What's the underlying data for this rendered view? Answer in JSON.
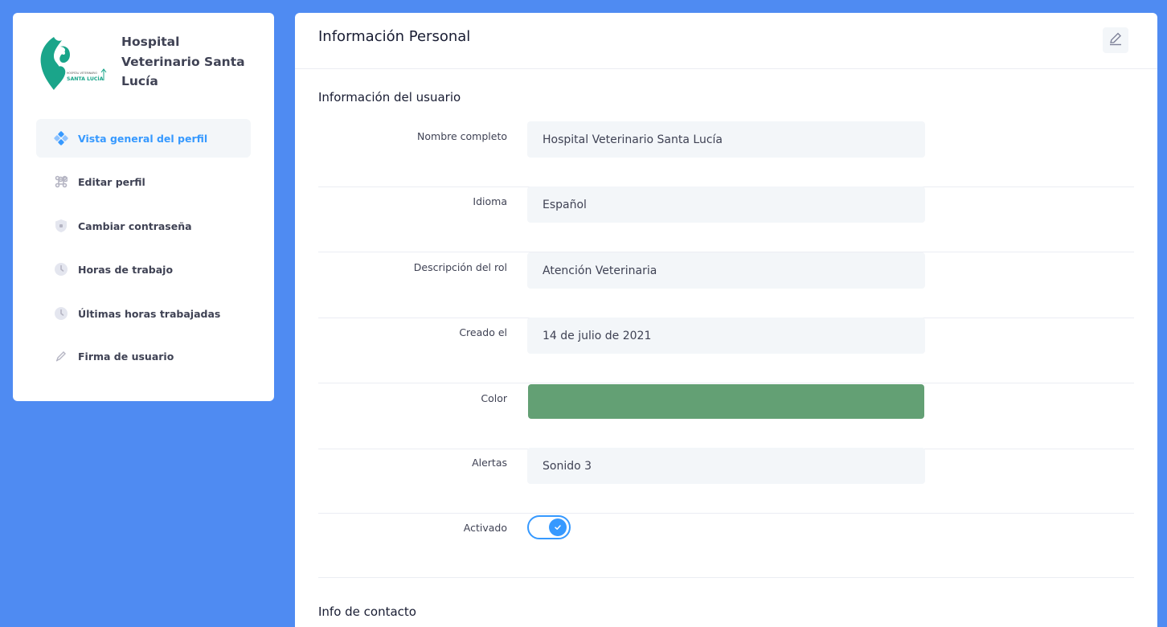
{
  "sidebar": {
    "brand_name": "Hospital Veterinario Santa Lucía",
    "logo_text_small": "HOSPITAL VETERINARIO",
    "logo_text_main": "SANTA LUCÍA",
    "logo_color": "#1aa58a",
    "items": [
      {
        "label": "Vista general del perfil",
        "icon": "profile-overview-icon",
        "active": true
      },
      {
        "label": "Editar perfil",
        "icon": "command-icon",
        "active": false
      },
      {
        "label": "Cambiar contraseña",
        "icon": "shield-icon",
        "active": false
      },
      {
        "label": "Horas de trabajo",
        "icon": "clock-icon",
        "active": false
      },
      {
        "label": "Últimas horas trabajadas",
        "icon": "clock-icon",
        "active": false
      },
      {
        "label": "Firma de usuario",
        "icon": "pen-icon",
        "active": false
      }
    ]
  },
  "main": {
    "title": "Información Personal",
    "edit_icon": "pencil-icon",
    "user_section_title": "Información del usuario",
    "fields": {
      "full_name": {
        "label": "Nombre completo",
        "value": "Hospital Veterinario Santa Lucía"
      },
      "language": {
        "label": "Idioma",
        "value": "Español"
      },
      "role": {
        "label": "Descripción del rol",
        "value": "Atención Veterinaria"
      },
      "created": {
        "label": "Creado el",
        "value": "14 de julio de 2021"
      },
      "color": {
        "label": "Color",
        "value": "#63a074"
      },
      "alerts": {
        "label": "Alertas",
        "value": "Sonido 3"
      },
      "enabled": {
        "label": "Activado",
        "value": true
      }
    },
    "contact_section_title": "Info de contacto"
  },
  "colors": {
    "background": "#4f8bf2",
    "accent": "#3699ff",
    "field_bg": "#f3f6f9"
  }
}
